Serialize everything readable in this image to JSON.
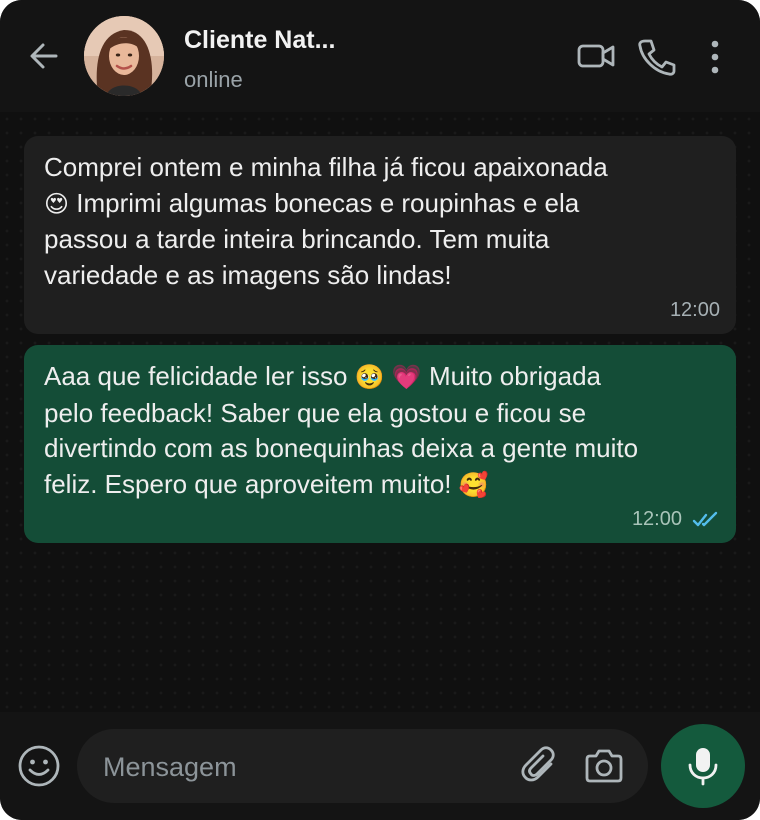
{
  "header": {
    "contact_name": "Cliente Nat...",
    "status": "online",
    "icons": [
      "back-arrow-icon",
      "video-call-icon",
      "phone-call-icon",
      "more-options-icon"
    ]
  },
  "messages": [
    {
      "direction": "incoming",
      "lines": [
        {
          "text": "Comprei ontem e minha filha já ficou apaixonada"
        },
        {
          "emoji": "😍",
          "text": " Imprimi algumas bonecas e roupinhas e ela"
        },
        {
          "text": "passou a tarde inteira brincando. Tem muita"
        },
        {
          "text": "variedade e as imagens são lindas!"
        }
      ],
      "time": "12:00"
    },
    {
      "direction": "outgoing",
      "lines": [
        {
          "text_before": "Aaa que felicidade ler isso ",
          "emoji1": "🥹",
          "emoji2": "💗",
          "text_after": " Muito obrigada"
        },
        {
          "text": "pelo feedback! Saber que ela gostou e ficou se"
        },
        {
          "text": "divertindo com as bonequinhas deixa a gente muito"
        },
        {
          "text": "feliz. Espero que aproveitem muito! ",
          "emoji": "🥰"
        }
      ],
      "time": "12:00",
      "read_status": "read",
      "tick_color": "#53bdeb"
    }
  ],
  "footer": {
    "placeholder": "Mensagem",
    "icons": [
      "emoji-icon",
      "attach-icon",
      "camera-icon",
      "mic-icon"
    ]
  },
  "colors": {
    "background": "#0b0b0b",
    "incoming_bubble": "#1f1f1f",
    "outgoing_bubble": "#144d37",
    "mic_button": "#145a3d"
  }
}
